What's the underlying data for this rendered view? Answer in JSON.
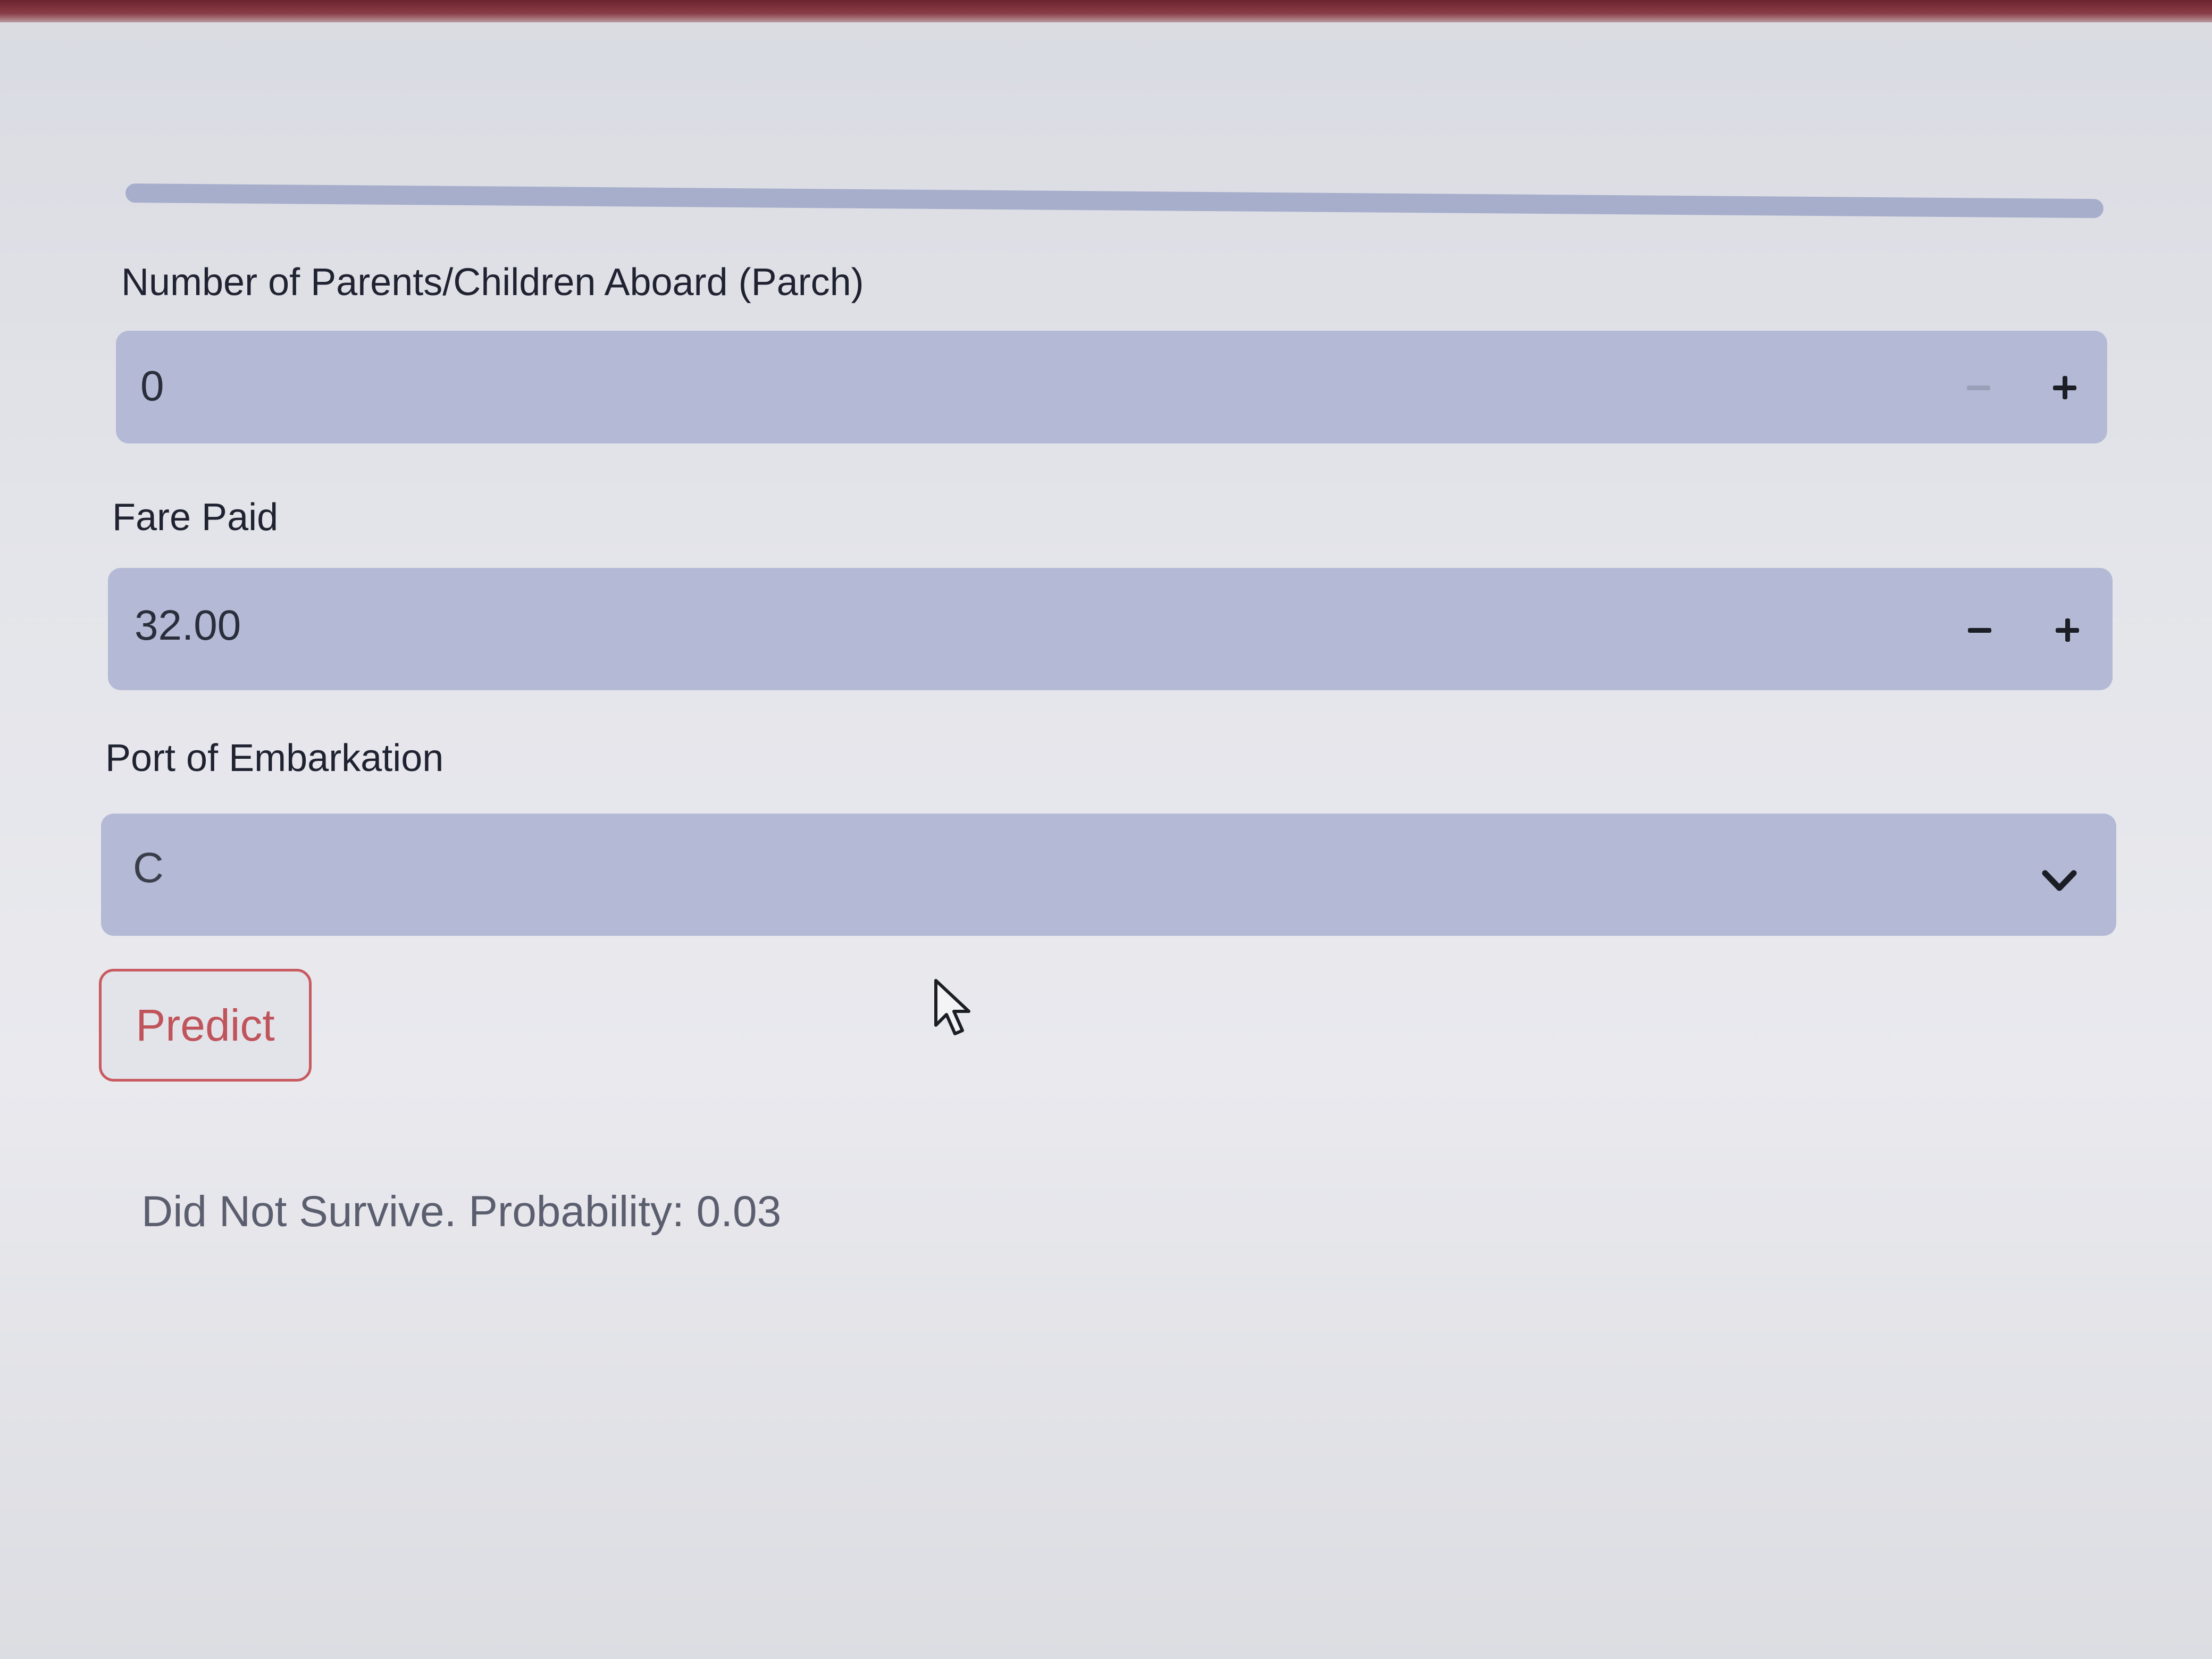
{
  "form": {
    "parch": {
      "label": "Number of Parents/Children Aboard (Parch)",
      "value": "0",
      "decrement_icon": "minus-icon",
      "increment_icon": "plus-icon"
    },
    "fare": {
      "label": "Fare Paid",
      "value": "32.00",
      "decrement_icon": "minus-icon",
      "increment_icon": "plus-icon"
    },
    "embarked": {
      "label": "Port of Embarkation",
      "selected": "C",
      "icon": "chevron-down-icon"
    },
    "predict_label": "Predict"
  },
  "result": {
    "text": "Did Not Survive. Probability: 0.03"
  },
  "colors": {
    "input_background": "#b4bad6",
    "predict_accent": "#c0545b",
    "page_background": "#e4e5ea"
  }
}
